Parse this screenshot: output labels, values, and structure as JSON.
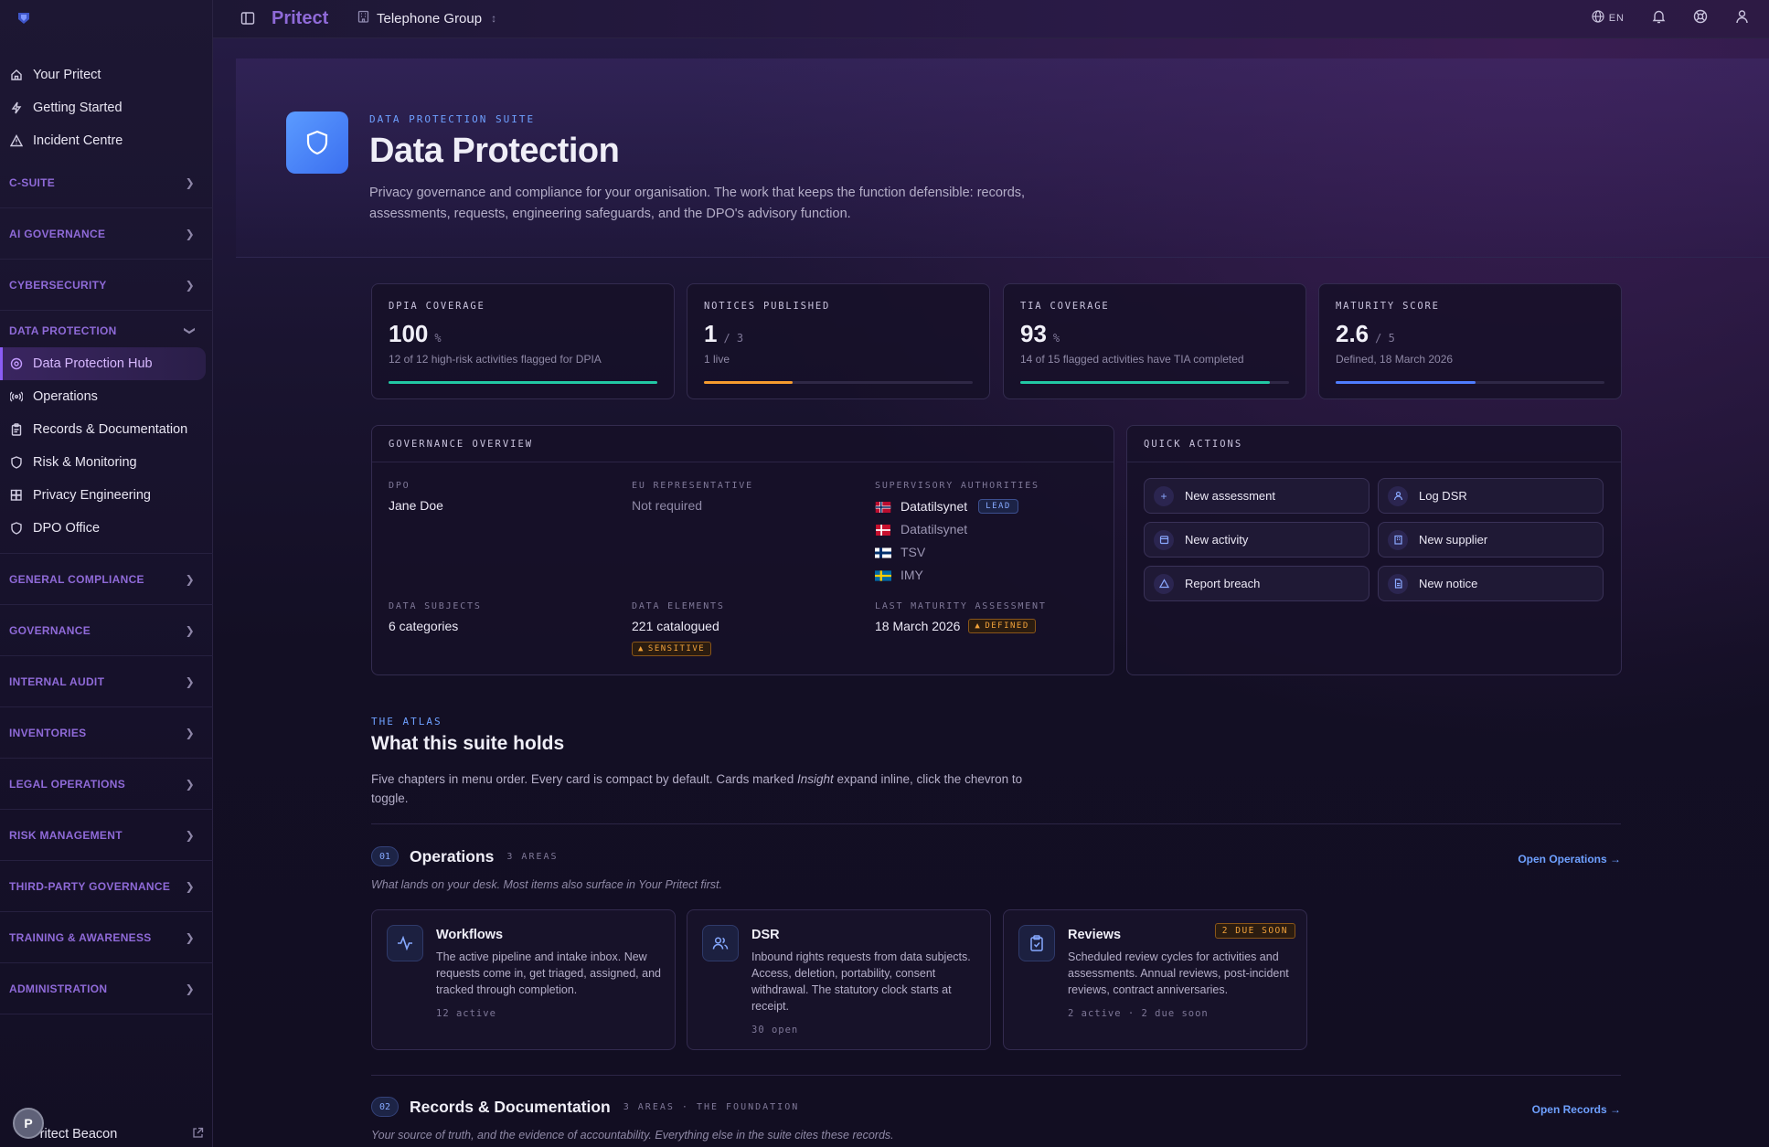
{
  "app": {
    "brand": "Pritect",
    "organisation": "Telephone Group",
    "language": "EN"
  },
  "sidebar": {
    "top_items": [
      {
        "label": "Your Pritect",
        "icon": "home-icon"
      },
      {
        "label": "Getting Started",
        "icon": "bolt-icon"
      },
      {
        "label": "Incident Centre",
        "icon": "alert-triangle-icon"
      }
    ],
    "sections_before": [
      {
        "label": "C-SUITE"
      },
      {
        "label": "AI GOVERNANCE"
      },
      {
        "label": "CYBERSECURITY"
      }
    ],
    "open_section": {
      "label": "DATA PROTECTION",
      "items": [
        {
          "label": "Data Protection Hub",
          "icon": "privacy-icon",
          "active": true
        },
        {
          "label": "Operations",
          "icon": "radio-waves-icon"
        },
        {
          "label": "Records & Documentation",
          "icon": "clipboard-icon"
        },
        {
          "label": "Risk & Monitoring",
          "icon": "shield-icon"
        },
        {
          "label": "Privacy Engineering",
          "icon": "blocks-icon"
        },
        {
          "label": "DPO Office",
          "icon": "shield-icon"
        }
      ]
    },
    "sections_after": [
      {
        "label": "GENERAL COMPLIANCE"
      },
      {
        "label": "GOVERNANCE"
      },
      {
        "label": "INTERNAL AUDIT"
      },
      {
        "label": "INVENTORIES"
      },
      {
        "label": "LEGAL OPERATIONS"
      },
      {
        "label": "RISK MANAGEMENT"
      },
      {
        "label": "THIRD-PARTY GOVERNANCE"
      },
      {
        "label": "TRAINING & AWARENESS"
      },
      {
        "label": "ADMINISTRATION"
      }
    ],
    "beacon_label": "Pritect Beacon",
    "avatar_initial": "P"
  },
  "hero": {
    "eyebrow": "DATA PROTECTION SUITE",
    "title": "Data Protection",
    "description": "Privacy governance and compliance for your organisation. The work that keeps the function defensible: records, assessments, requests, engineering safeguards, and the DPO's advisory function."
  },
  "stats": [
    {
      "label": "DPIA COVERAGE",
      "value": "100",
      "unit": "%",
      "sub": "12 of 12 high-risk activities flagged for DPIA",
      "progress": 1.0,
      "color": "#22c8a4"
    },
    {
      "label": "NOTICES PUBLISHED",
      "value": "1",
      "unit": "/ 3",
      "sub": "1 live",
      "progress": 0.33,
      "color": "#f59b2e"
    },
    {
      "label": "TIA COVERAGE",
      "value": "93",
      "unit": "%",
      "sub": "14 of 15 flagged activities have TIA completed",
      "progress": 0.93,
      "color": "#22c8a4"
    },
    {
      "label": "MATURITY SCORE",
      "value": "2.6",
      "unit": "/ 5",
      "sub": "Defined, 18 March 2026",
      "progress": 0.52,
      "color": "#4f7dff"
    }
  ],
  "governance": {
    "title": "GOVERNANCE OVERVIEW",
    "dpo": {
      "label": "DPO",
      "value": "Jane Doe"
    },
    "eu_rep": {
      "label": "EU REPRESENTATIVE",
      "value": "Not required"
    },
    "authorities": {
      "label": "SUPERVISORY AUTHORITIES",
      "lead_badge": "LEAD",
      "items": [
        {
          "name": "Datatilsynet",
          "flag": "norway"
        },
        {
          "name": "Datatilsynet",
          "flag": "denmark"
        },
        {
          "name": "TSV",
          "flag": "finland"
        },
        {
          "name": "IMY",
          "flag": "sweden"
        }
      ]
    },
    "data_subjects": {
      "label": "DATA SUBJECTS",
      "value": "6 categories"
    },
    "data_elements": {
      "label": "DATA ELEMENTS",
      "value": "221 catalogued",
      "badge": "SENSITIVE"
    },
    "last_maturity": {
      "label": "LAST MATURITY ASSESSMENT",
      "value": "18 March 2026",
      "badge": "DEFINED"
    }
  },
  "quick_actions": {
    "title": "QUICK ACTIONS",
    "items": [
      {
        "label": "New assessment",
        "icon": "plus-icon"
      },
      {
        "label": "Log DSR",
        "icon": "user-icon"
      },
      {
        "label": "New activity",
        "icon": "calendar-icon"
      },
      {
        "label": "New supplier",
        "icon": "building-icon"
      },
      {
        "label": "Report breach",
        "icon": "alert-triangle-icon"
      },
      {
        "label": "New notice",
        "icon": "document-icon"
      }
    ]
  },
  "atlas": {
    "eyebrow": "THE ATLAS",
    "title": "What this suite holds",
    "desc_before": "Five chapters in menu order. Every card is compact by default. Cards marked ",
    "desc_em": "Insight",
    "desc_after": " expand inline, click the chevron to toggle."
  },
  "operations": {
    "num": "01",
    "title": "Operations",
    "meta": "3 AREAS",
    "link": "Open Operations →",
    "subtitle": "What lands on your desk. Most items also surface in Your Pritect first.",
    "cards": [
      {
        "title": "Workflows",
        "icon": "activity-icon",
        "desc": "The active pipeline and intake inbox. New requests come in, get triaged, assigned, and tracked through completion.",
        "meta": "12 active"
      },
      {
        "title": "DSR",
        "icon": "users-icon",
        "desc": "Inbound rights requests from data subjects. Access, deletion, portability, consent withdrawal. The statutory clock starts at receipt.",
        "meta": "30 open"
      },
      {
        "title": "Reviews",
        "icon": "clipboard-check-icon",
        "desc": "Scheduled review cycles for activities and assessments. Annual reviews, post-incident reviews, contract anniversaries.",
        "meta": "2 active · 2 due soon",
        "badge": "2 DUE SOON"
      }
    ]
  },
  "records": {
    "num": "02",
    "title": "Records & Documentation",
    "meta": "3 AREAS · THE FOUNDATION",
    "link": "Open Records →",
    "subtitle": "Your source of truth, and the evidence of accountability. Everything else in the suite cites these records."
  }
}
